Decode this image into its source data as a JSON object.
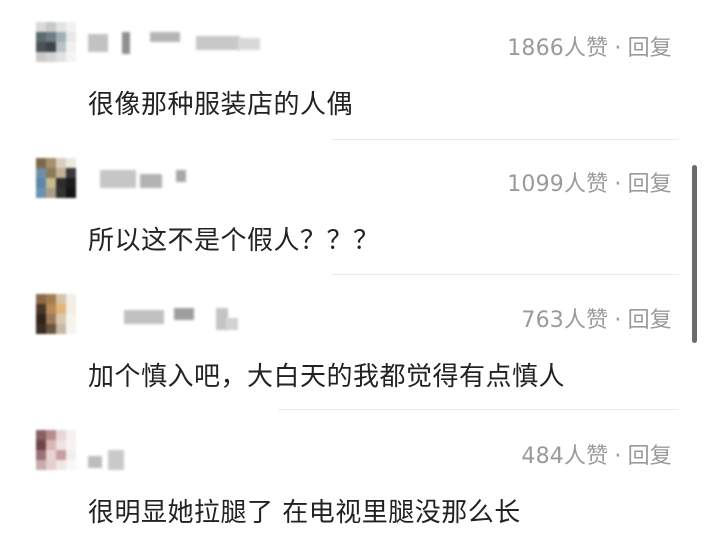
{
  "colors": {
    "text": "#222222",
    "meta": "#9a9a9a",
    "divider": "#ebebeb",
    "scrollbar": "#6b6b6b"
  },
  "comments": [
    {
      "likes": "1866人赞",
      "separator": "·",
      "reply": "回复",
      "text": "很像那种服装店的人偶"
    },
    {
      "likes": "1099人赞",
      "separator": "·",
      "reply": "回复",
      "text": "所以这不是个假人？？？"
    },
    {
      "likes": "763人赞",
      "separator": "·",
      "reply": "回复",
      "text": "加个慎入吧，大白天的我都觉得有点慎人"
    },
    {
      "likes": "484人赞",
      "separator": "·",
      "reply": "回复",
      "text": "很明显她拉腿了 在电视里腿没那么长"
    }
  ]
}
